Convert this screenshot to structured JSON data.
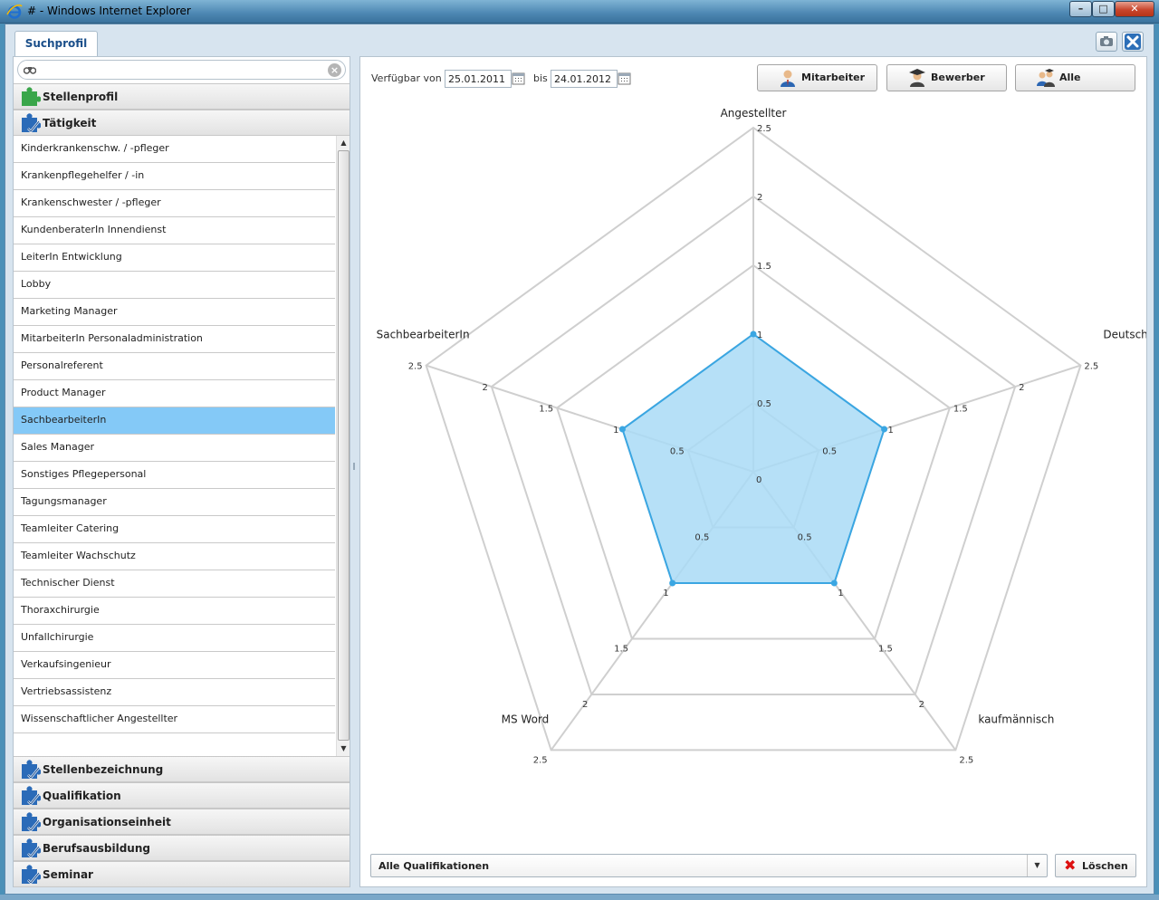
{
  "window": {
    "title": "# - Windows Internet Explorer",
    "min": "–",
    "max": "□",
    "close": "✕"
  },
  "app": {
    "tab_label": "Suchprofil"
  },
  "search": {
    "value": "",
    "placeholder": ""
  },
  "accordion_top": [
    {
      "label": "Stellenprofil",
      "icon": "puzzle-green-icon"
    },
    {
      "label": "Tätigkeit",
      "icon": "puzzle-check-icon"
    }
  ],
  "list_items": [
    "Kinderkrankenschw. / -pfleger",
    "Krankenpflegehelfer / -in",
    "Krankenschwester / -pfleger",
    "KundenberaterIn Innendienst",
    "LeiterIn Entwicklung",
    "Lobby",
    "Marketing Manager",
    "MitarbeiterIn Personaladministration",
    "Personalreferent",
    "Product Manager",
    "SachbearbeiterIn",
    "Sales Manager",
    "Sonstiges Pflegepersonal",
    "Tagungsmanager",
    "Teamleiter Catering",
    "Teamleiter Wachschutz",
    "Technischer Dienst",
    "Thoraxchirurgie",
    "Unfallchirurgie",
    "Verkaufsingenieur",
    "Vertriebsassistenz",
    "Wissenschaftlicher Angestellter"
  ],
  "selected_item": "SachbearbeiterIn",
  "accordion_bottom": [
    {
      "label": "Stellenbezeichnung"
    },
    {
      "label": "Qualifikation"
    },
    {
      "label": "Organisationseinheit"
    },
    {
      "label": "Berufsausbildung"
    },
    {
      "label": "Seminar"
    }
  ],
  "filter": {
    "from_label": "Verfügbar von",
    "from_value": "25.01.2011",
    "to_label": "bis",
    "to_value": "24.01.2012"
  },
  "role_buttons": [
    {
      "label": "Mitarbeiter"
    },
    {
      "label": "Bewerber"
    },
    {
      "label": "Alle"
    }
  ],
  "qualification_select": {
    "value": "Alle Qualifikationen"
  },
  "delete_label": "Löschen",
  "colors": {
    "fill": "#a9dbf6",
    "stroke": "#3aa6e2",
    "selected": "#84c9f7"
  },
  "chart_data": {
    "type": "radar",
    "axes": [
      "Angestellter",
      "Deutsch",
      "kaufmännisch",
      "MS Word",
      "SachbearbeiterIn"
    ],
    "ticks": [
      0.5,
      1,
      1.5,
      2,
      2.5
    ],
    "tick_labels": [
      "0.5",
      "1",
      "1.5",
      "2",
      "2.5"
    ],
    "center_label": "0",
    "range": [
      0,
      2.5
    ],
    "series": [
      {
        "values": [
          1,
          1,
          1,
          1,
          1
        ]
      }
    ]
  }
}
